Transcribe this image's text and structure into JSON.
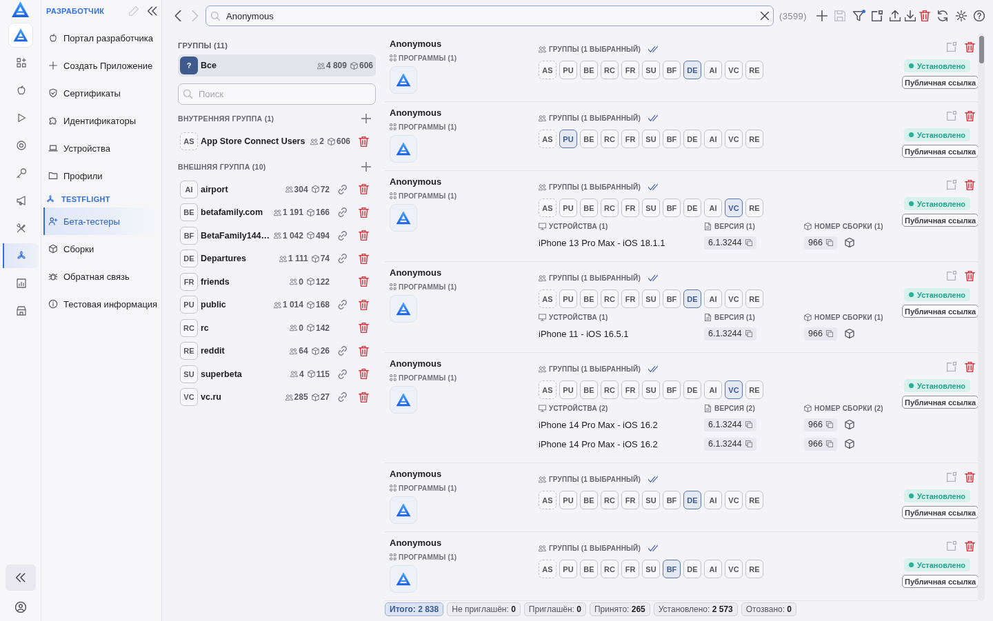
{
  "icon_rail": [
    {
      "selected": false
    },
    {
      "selected": false
    },
    {
      "selected": false
    },
    {
      "selected": false
    },
    {
      "selected": false
    },
    {
      "selected": false
    },
    {
      "selected": false
    },
    {
      "selected": true
    },
    {
      "selected": false
    },
    {
      "selected": false
    }
  ],
  "sidebar": {
    "title": "РАЗРАБОТЧИК",
    "developer_items": [
      {
        "label": "Портал разработчика",
        "selected": false
      },
      {
        "label": "Создать Приложение",
        "selected": false
      },
      {
        "label": "Сертификаты",
        "selected": false
      },
      {
        "label": "Идентификаторы",
        "selected": false
      },
      {
        "label": "Устройства",
        "selected": false
      },
      {
        "label": "Профили",
        "selected": false
      }
    ],
    "testflight_title": "TESTFLIGHT",
    "testflight_items": [
      {
        "label": "Бета-тестеры",
        "selected": true
      },
      {
        "label": "Сборки",
        "selected": false
      },
      {
        "label": "Обратная связь",
        "selected": false
      },
      {
        "label": "Тестовая информация",
        "selected": false
      }
    ]
  },
  "toolbar": {
    "search": {
      "value": "Anonymous"
    },
    "count": "(3599)",
    "filter_active": true
  },
  "groups": {
    "title": "ГРУППЫ (11)",
    "all": {
      "badge": "?",
      "name": "Все",
      "testers": "4 809",
      "builds": "606",
      "selected": true
    },
    "search": {
      "placeholder": "Поиск"
    },
    "internal": {
      "title": "ВНУТРЕННЯЯ ГРУППА (1)",
      "items": [
        {
          "code": "AS",
          "name": "App Store Connect Users",
          "testers": "2",
          "builds": "606"
        }
      ]
    },
    "external": {
      "title": "ВНЕШНЯЯ ГРУППА (10)",
      "items": [
        {
          "code": "AI",
          "name": "airport",
          "testers": "304",
          "builds": "72",
          "link": true
        },
        {
          "code": "BE",
          "name": "betafamily.com",
          "testers": "1 191",
          "builds": "166",
          "link": true
        },
        {
          "code": "BF",
          "name": "BetaFamily144…",
          "testers": "1 042",
          "builds": "494",
          "link": true
        },
        {
          "code": "DE",
          "name": "Departures",
          "testers": "1 111",
          "builds": "74",
          "link": true
        },
        {
          "code": "FR",
          "name": "friends",
          "testers": "0",
          "builds": "122",
          "link": false
        },
        {
          "code": "PU",
          "name": "public",
          "testers": "1 014",
          "builds": "168",
          "link": true
        },
        {
          "code": "RC",
          "name": "rc",
          "testers": "0",
          "builds": "142",
          "link": false
        },
        {
          "code": "RE",
          "name": "reddit",
          "testers": "64",
          "builds": "26",
          "link": true
        },
        {
          "code": "SU",
          "name": "superbeta",
          "testers": "4",
          "builds": "115",
          "link": true
        },
        {
          "code": "VC",
          "name": "vc.ru",
          "testers": "285",
          "builds": "27",
          "link": true
        }
      ]
    }
  },
  "testers": [
    {
      "name": "Anonymous",
      "programs_label": "ПРОГРАММЫ (1)",
      "groups_label": "ГРУППЫ (1 ВЫБРАННЫЙ)",
      "groups": [
        {
          "code": "AS",
          "kind": "internal",
          "selected": false
        },
        {
          "code": "PU",
          "kind": "external",
          "selected": false
        },
        {
          "code": "BE",
          "kind": "external",
          "selected": false
        },
        {
          "code": "RC",
          "kind": "external",
          "selected": false
        },
        {
          "code": "FR",
          "kind": "external",
          "selected": false
        },
        {
          "code": "SU",
          "kind": "external",
          "selected": false
        },
        {
          "code": "BF",
          "kind": "external",
          "selected": false
        },
        {
          "code": "DE",
          "kind": "external",
          "selected": true
        },
        {
          "code": "AI",
          "kind": "external",
          "selected": false
        },
        {
          "code": "VC",
          "kind": "external",
          "selected": false
        },
        {
          "code": "RE",
          "kind": "external",
          "selected": false
        }
      ],
      "status": "Установлено",
      "public_link": "Публичная ссылка"
    },
    {
      "name": "Anonymous",
      "programs_label": "ПРОГРАММЫ (1)",
      "groups_label": "ГРУППЫ (1 ВЫБРАННЫЙ)",
      "groups": [
        {
          "code": "AS",
          "kind": "internal",
          "selected": false
        },
        {
          "code": "PU",
          "kind": "external",
          "selected": true
        },
        {
          "code": "BE",
          "kind": "external",
          "selected": false
        },
        {
          "code": "RC",
          "kind": "external",
          "selected": false
        },
        {
          "code": "FR",
          "kind": "external",
          "selected": false
        },
        {
          "code": "SU",
          "kind": "external",
          "selected": false
        },
        {
          "code": "BF",
          "kind": "external",
          "selected": false
        },
        {
          "code": "DE",
          "kind": "external",
          "selected": false
        },
        {
          "code": "AI",
          "kind": "external",
          "selected": false
        },
        {
          "code": "VC",
          "kind": "external",
          "selected": false
        },
        {
          "code": "RE",
          "kind": "external",
          "selected": false
        }
      ],
      "status": "Установлено",
      "public_link": "Публичная ссылка"
    },
    {
      "name": "Anonymous",
      "programs_label": "ПРОГРАММЫ (1)",
      "groups_label": "ГРУППЫ (1 ВЫБРАННЫЙ)",
      "groups": [
        {
          "code": "AS",
          "kind": "internal",
          "selected": false
        },
        {
          "code": "PU",
          "kind": "external",
          "selected": false
        },
        {
          "code": "BE",
          "kind": "external",
          "selected": false
        },
        {
          "code": "RC",
          "kind": "external",
          "selected": false
        },
        {
          "code": "FR",
          "kind": "external",
          "selected": false
        },
        {
          "code": "SU",
          "kind": "external",
          "selected": false
        },
        {
          "code": "BF",
          "kind": "external",
          "selected": false
        },
        {
          "code": "DE",
          "kind": "external",
          "selected": false
        },
        {
          "code": "AI",
          "kind": "external",
          "selected": false
        },
        {
          "code": "VC",
          "kind": "external",
          "selected": true
        },
        {
          "code": "RE",
          "kind": "external",
          "selected": false
        }
      ],
      "devices": {
        "title": "УСТРОЙСТВА (1)",
        "version_title": "ВЕРСИЯ (1)",
        "build_title": "НОМЕР СБОРКИ (1)",
        "rows": [
          {
            "device": "iPhone 13 Pro Max - iOS 18.1.1",
            "version": "6.1.3244",
            "build": "966"
          }
        ]
      },
      "status": "Установлено",
      "public_link": "Публичная ссылка"
    },
    {
      "name": "Anonymous",
      "programs_label": "ПРОГРАММЫ (1)",
      "groups_label": "ГРУППЫ (1 ВЫБРАННЫЙ)",
      "groups": [
        {
          "code": "AS",
          "kind": "internal",
          "selected": false
        },
        {
          "code": "PU",
          "kind": "external",
          "selected": false
        },
        {
          "code": "BE",
          "kind": "external",
          "selected": false
        },
        {
          "code": "RC",
          "kind": "external",
          "selected": false
        },
        {
          "code": "FR",
          "kind": "external",
          "selected": false
        },
        {
          "code": "SU",
          "kind": "external",
          "selected": false
        },
        {
          "code": "BF",
          "kind": "external",
          "selected": false
        },
        {
          "code": "DE",
          "kind": "external",
          "selected": true
        },
        {
          "code": "AI",
          "kind": "external",
          "selected": false
        },
        {
          "code": "VC",
          "kind": "external",
          "selected": false
        },
        {
          "code": "RE",
          "kind": "external",
          "selected": false
        }
      ],
      "devices": {
        "title": "УСТРОЙСТВА (1)",
        "version_title": "ВЕРСИЯ (1)",
        "build_title": "НОМЕР СБОРКИ (1)",
        "rows": [
          {
            "device": "iPhone 11 - iOS 16.5.1",
            "version": "6.1.3244",
            "build": "966"
          }
        ]
      },
      "status": "Установлено",
      "public_link": "Публичная ссылка"
    },
    {
      "name": "Anonymous",
      "programs_label": "ПРОГРАММЫ (1)",
      "groups_label": "ГРУППЫ (1 ВЫБРАННЫЙ)",
      "groups": [
        {
          "code": "AS",
          "kind": "internal",
          "selected": false
        },
        {
          "code": "PU",
          "kind": "external",
          "selected": false
        },
        {
          "code": "BE",
          "kind": "external",
          "selected": false
        },
        {
          "code": "RC",
          "kind": "external",
          "selected": false
        },
        {
          "code": "FR",
          "kind": "external",
          "selected": false
        },
        {
          "code": "SU",
          "kind": "external",
          "selected": false
        },
        {
          "code": "BF",
          "kind": "external",
          "selected": false
        },
        {
          "code": "DE",
          "kind": "external",
          "selected": false
        },
        {
          "code": "AI",
          "kind": "external",
          "selected": false
        },
        {
          "code": "VC",
          "kind": "external",
          "selected": true
        },
        {
          "code": "RE",
          "kind": "external",
          "selected": false
        }
      ],
      "devices": {
        "title": "УСТРОЙСТВА (2)",
        "version_title": "ВЕРСИЯ (2)",
        "build_title": "НОМЕР СБОРКИ (2)",
        "rows": [
          {
            "device": "iPhone 14 Pro Max - iOS 16.2",
            "version": "6.1.3244",
            "build": "966"
          },
          {
            "device": "iPhone 14 Pro Max - iOS 16.2",
            "version": "6.1.3244",
            "build": "966"
          }
        ]
      },
      "status": "Установлено",
      "public_link": "Публичная ссылка"
    },
    {
      "name": "Anonymous",
      "programs_label": "ПРОГРАММЫ (1)",
      "groups_label": "ГРУППЫ (1 ВЫБРАННЫЙ)",
      "groups": [
        {
          "code": "AS",
          "kind": "internal",
          "selected": false
        },
        {
          "code": "PU",
          "kind": "external",
          "selected": false
        },
        {
          "code": "BE",
          "kind": "external",
          "selected": false
        },
        {
          "code": "RC",
          "kind": "external",
          "selected": false
        },
        {
          "code": "FR",
          "kind": "external",
          "selected": false
        },
        {
          "code": "SU",
          "kind": "external",
          "selected": false
        },
        {
          "code": "BF",
          "kind": "external",
          "selected": false
        },
        {
          "code": "DE",
          "kind": "external",
          "selected": true
        },
        {
          "code": "AI",
          "kind": "external",
          "selected": false
        },
        {
          "code": "VC",
          "kind": "external",
          "selected": false
        },
        {
          "code": "RE",
          "kind": "external",
          "selected": false
        }
      ],
      "status": "Установлено",
      "public_link": "Публичная ссылка"
    },
    {
      "name": "Anonymous",
      "programs_label": "ПРОГРАММЫ (1)",
      "groups_label": "ГРУППЫ (1 ВЫБРАННЫЙ)",
      "groups": [
        {
          "code": "AS",
          "kind": "internal",
          "selected": false
        },
        {
          "code": "PU",
          "kind": "external",
          "selected": false
        },
        {
          "code": "BE",
          "kind": "external",
          "selected": false
        },
        {
          "code": "RC",
          "kind": "external",
          "selected": false
        },
        {
          "code": "FR",
          "kind": "external",
          "selected": false
        },
        {
          "code": "SU",
          "kind": "external",
          "selected": false
        },
        {
          "code": "BF",
          "kind": "external",
          "selected": true
        },
        {
          "code": "DE",
          "kind": "external",
          "selected": false
        },
        {
          "code": "AI",
          "kind": "external",
          "selected": false
        },
        {
          "code": "VC",
          "kind": "external",
          "selected": false
        },
        {
          "code": "RE",
          "kind": "external",
          "selected": false
        }
      ],
      "status": "Установлено",
      "public_link": "Публичная ссылка"
    }
  ],
  "summary": [
    {
      "label": "Итого:",
      "value": "2 838",
      "selected": true
    },
    {
      "label": "Не приглашён:",
      "value": "0",
      "selected": false
    },
    {
      "label": "Приглашён:",
      "value": "0",
      "selected": false
    },
    {
      "label": "Принято:",
      "value": "265",
      "selected": false
    },
    {
      "label": "Установлено:",
      "value": "2 573",
      "selected": false
    },
    {
      "label": "Отозвано:",
      "value": "0",
      "selected": false
    }
  ]
}
